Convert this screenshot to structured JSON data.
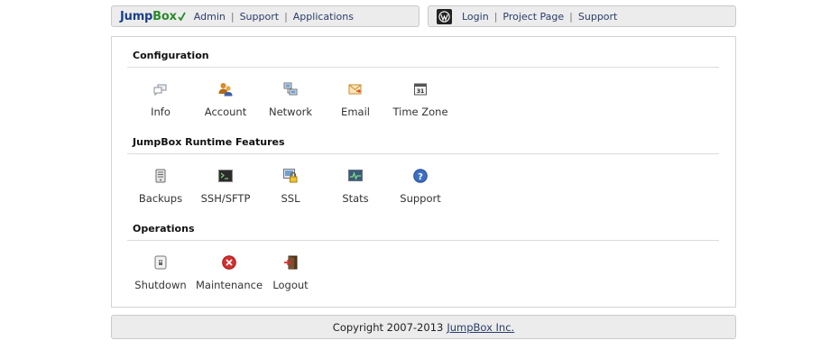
{
  "header_left": {
    "logo_text_jump": "Jump",
    "logo_text_box": "Box",
    "links": [
      {
        "label": "Admin"
      },
      {
        "label": "Support"
      },
      {
        "label": "Applications"
      }
    ]
  },
  "header_right": {
    "links": [
      {
        "label": "Login"
      },
      {
        "label": "Project Page"
      },
      {
        "label": "Support"
      }
    ]
  },
  "sections": [
    {
      "title": "Configuration",
      "items": [
        {
          "label": "Info",
          "icon": "info-icon"
        },
        {
          "label": "Account",
          "icon": "account-icon"
        },
        {
          "label": "Network",
          "icon": "network-icon"
        },
        {
          "label": "Email",
          "icon": "email-icon"
        },
        {
          "label": "Time Zone",
          "icon": "calendar-icon"
        }
      ]
    },
    {
      "title": "JumpBox Runtime Features",
      "items": [
        {
          "label": "Backups",
          "icon": "backup-icon"
        },
        {
          "label": "SSH/SFTP",
          "icon": "terminal-icon"
        },
        {
          "label": "SSL",
          "icon": "lock-icon"
        },
        {
          "label": "Stats",
          "icon": "stats-icon"
        },
        {
          "label": "Support",
          "icon": "help-icon"
        }
      ]
    },
    {
      "title": "Operations",
      "items": [
        {
          "label": "Shutdown",
          "icon": "power-switch-icon"
        },
        {
          "label": "Maintenance",
          "icon": "maintenance-icon"
        },
        {
          "label": "Logout",
          "icon": "logout-icon"
        }
      ]
    }
  ],
  "footer": {
    "copyright": "Copyright 2007-2013",
    "link": "JumpBox Inc."
  },
  "colors": {
    "bar_bg": "#ececec",
    "link": "#2a3d6a",
    "logo_blue": "#1a3f8f",
    "logo_green": "#2a8a2a"
  }
}
